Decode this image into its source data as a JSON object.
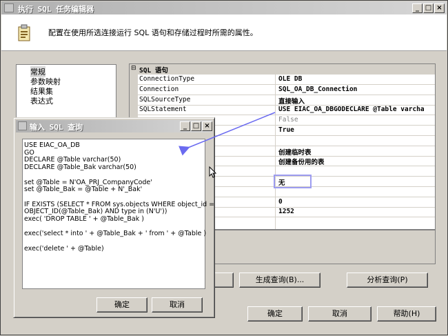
{
  "window": {
    "title": "执行 SQL 任务编辑器",
    "header_text": "配置在使用所选连接运行 SQL 语句和存储过程时所需的属性。"
  },
  "nav": {
    "items": [
      "常规",
      "参数映射",
      "结果集",
      "表达式"
    ]
  },
  "grid": {
    "section": "SQL 语句",
    "rows": [
      {
        "name": "ConnectionType",
        "value": "OLE DB"
      },
      {
        "name": "Connection",
        "value": "SQL_OA_DB_Connection"
      },
      {
        "name": "SQLSourceType",
        "value": "直接输入"
      },
      {
        "name": "SQLStatement",
        "value": "USE EIAC_OA_DBGODECLARE @Table varcha"
      },
      {
        "name": "re",
        "value": "False"
      },
      {
        "name": "",
        "value": "True"
      },
      {
        "name": "",
        "value": ""
      },
      {
        "name": "",
        "value": "创建临时表"
      },
      {
        "name": "",
        "value": "创建备份用的表"
      },
      {
        "name": "",
        "value": ""
      },
      {
        "name": "",
        "value": "无"
      },
      {
        "name": "",
        "value": ""
      },
      {
        "name": "",
        "value": "0"
      },
      {
        "name": "",
        "value": "1252"
      }
    ]
  },
  "buttons": {
    "build_query": "生成查询(B)...",
    "parse_query": "分析查询(P)",
    "ok": "确定",
    "cancel": "取消",
    "help": "帮助(H)"
  },
  "dialog": {
    "title": "输入 SQL 查询",
    "sql_lines": [
      "USE EIAC_OA_DB",
      "GO",
      "DECLARE @Table varchar(50)",
      "DECLARE @Table_Bak varchar(50)",
      "",
      "set @Table = N'OA_PRJ_CompanyCode'",
      "set @Table_Bak = @Table + N'_Bak'",
      "",
      "IF  EXISTS (SELECT * FROM sys.objects WHERE object_id =",
      "OBJECT_ID(@Table_Bak) AND type in (N'U'))",
      "exec( 'DROP TABLE ' + @Table_Bak )",
      "",
      "exec('select * into ' + @Table_Bak + ' from ' + @Table )",
      "",
      "exec('delete ' + @Table)"
    ],
    "ok": "确定",
    "cancel": "取消"
  },
  "colors": {
    "arrow": "#6b6bf0",
    "selection_border": "#9c9cf0"
  }
}
